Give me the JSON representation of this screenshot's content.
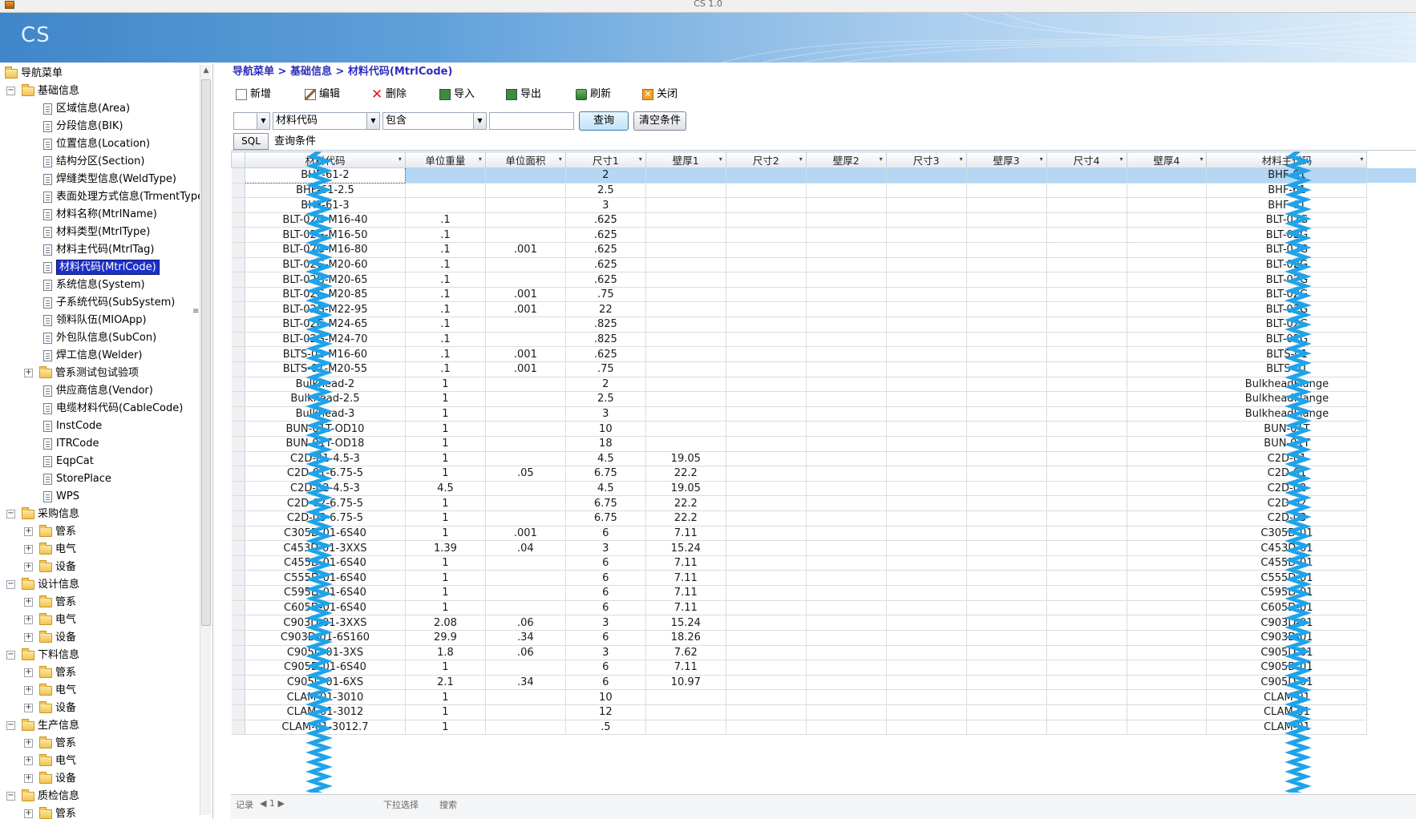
{
  "window": {
    "title": "CS 1.0"
  },
  "banner": {
    "logo": "CS"
  },
  "nav": {
    "root": "导航菜单",
    "items": [
      {
        "label": "基础信息",
        "level": 1,
        "kind": "folder",
        "expander": "−"
      },
      {
        "label": "区域信息(Area)",
        "level": 2,
        "kind": "doc"
      },
      {
        "label": "分段信息(BIK)",
        "level": 2,
        "kind": "doc"
      },
      {
        "label": "位置信息(Location)",
        "level": 2,
        "kind": "doc"
      },
      {
        "label": "结构分区(Section)",
        "level": 2,
        "kind": "doc"
      },
      {
        "label": "焊缝类型信息(WeldType)",
        "level": 2,
        "kind": "doc"
      },
      {
        "label": "表面处理方式信息(TrmentType)",
        "level": 2,
        "kind": "doc"
      },
      {
        "label": "材料名称(MtrlName)",
        "level": 2,
        "kind": "doc"
      },
      {
        "label": "材料类型(MtrlType)",
        "level": 2,
        "kind": "doc"
      },
      {
        "label": "材料主代码(MtrlTag)",
        "level": 2,
        "kind": "doc"
      },
      {
        "label": "材料代码(MtrlCode)",
        "level": 2,
        "kind": "doc",
        "selected": true
      },
      {
        "label": "系统信息(System)",
        "level": 2,
        "kind": "doc"
      },
      {
        "label": "子系统代码(SubSystem)",
        "level": 2,
        "kind": "doc"
      },
      {
        "label": "领料队伍(MIOApp)",
        "level": 2,
        "kind": "doc"
      },
      {
        "label": "外包队信息(SubCon)",
        "level": 2,
        "kind": "doc"
      },
      {
        "label": "焊工信息(Welder)",
        "level": 2,
        "kind": "doc"
      },
      {
        "label": "管系测试包试验项",
        "level": 2,
        "kind": "folder",
        "expander": "+"
      },
      {
        "label": "供应商信息(Vendor)",
        "level": 2,
        "kind": "doc"
      },
      {
        "label": "电缆材料代码(CableCode)",
        "level": 2,
        "kind": "doc"
      },
      {
        "label": "InstCode",
        "level": 2,
        "kind": "doc"
      },
      {
        "label": "ITRCode",
        "level": 2,
        "kind": "doc"
      },
      {
        "label": "EqpCat",
        "level": 2,
        "kind": "doc"
      },
      {
        "label": "StorePlace",
        "level": 2,
        "kind": "doc"
      },
      {
        "label": "WPS",
        "level": 2,
        "kind": "doc"
      },
      {
        "label": "采购信息",
        "level": 1,
        "kind": "folder",
        "expander": "−"
      },
      {
        "label": "管系",
        "level": 2,
        "kind": "folder",
        "expander": "+"
      },
      {
        "label": "电气",
        "level": 2,
        "kind": "folder",
        "expander": "+"
      },
      {
        "label": "设备",
        "level": 2,
        "kind": "folder",
        "expander": "+"
      },
      {
        "label": "设计信息",
        "level": 1,
        "kind": "folder",
        "expander": "−"
      },
      {
        "label": "管系",
        "level": 2,
        "kind": "folder",
        "expander": "+"
      },
      {
        "label": "电气",
        "level": 2,
        "kind": "folder",
        "expander": "+"
      },
      {
        "label": "设备",
        "level": 2,
        "kind": "folder",
        "expander": "+"
      },
      {
        "label": "下料信息",
        "level": 1,
        "kind": "folder",
        "expander": "−"
      },
      {
        "label": "管系",
        "level": 2,
        "kind": "folder",
        "expander": "+"
      },
      {
        "label": "电气",
        "level": 2,
        "kind": "folder",
        "expander": "+"
      },
      {
        "label": "设备",
        "level": 2,
        "kind": "folder",
        "expander": "+"
      },
      {
        "label": "生产信息",
        "level": 1,
        "kind": "folder",
        "expander": "−"
      },
      {
        "label": "管系",
        "level": 2,
        "kind": "folder",
        "expander": "+"
      },
      {
        "label": "电气",
        "level": 2,
        "kind": "folder",
        "expander": "+"
      },
      {
        "label": "设备",
        "level": 2,
        "kind": "folder",
        "expander": "+"
      },
      {
        "label": "质检信息",
        "level": 1,
        "kind": "folder",
        "expander": "−"
      },
      {
        "label": "管系",
        "level": 2,
        "kind": "folder",
        "expander": "+"
      }
    ]
  },
  "breadcrumb": "导航菜单 > 基础信息 > 材料代码(MtrlCode)",
  "toolbar": {
    "new": "新增",
    "edit": "编辑",
    "delete": "删除",
    "import": "导入",
    "export": "导出",
    "refresh": "刷新",
    "close": "关闭"
  },
  "filter": {
    "logic_value": "",
    "field_value": "材料代码",
    "operator_value": "包含",
    "keyword_value": "",
    "query": "查询",
    "clear": "清空条件"
  },
  "sqlbar": {
    "sql": "SQL",
    "label": "查询条件"
  },
  "grid": {
    "columns": [
      "材料代码",
      "单位重量",
      "单位面积",
      "尺寸1",
      "壁厚1",
      "尺寸2",
      "壁厚2",
      "尺寸3",
      "壁厚3",
      "尺寸4",
      "壁厚4",
      "材料主代码"
    ],
    "rows": [
      [
        "BHF-61-2",
        "",
        "",
        "2",
        "",
        "",
        "",
        "",
        "",
        "",
        "",
        "BHF-61"
      ],
      [
        "BHF-61-2.5",
        "",
        "",
        "2.5",
        "",
        "",
        "",
        "",
        "",
        "",
        "",
        "BHF-61"
      ],
      [
        "BHF-61-3",
        "",
        "",
        "3",
        "",
        "",
        "",
        "",
        "",
        "",
        "",
        "BHF-61"
      ],
      [
        "BLT-02G-M16-40",
        ".1",
        "",
        ".625",
        "",
        "",
        "",
        "",
        "",
        "",
        "",
        "BLT-02G"
      ],
      [
        "BLT-02G-M16-50",
        ".1",
        "",
        ".625",
        "",
        "",
        "",
        "",
        "",
        "",
        "",
        "BLT-02G"
      ],
      [
        "BLT-02G-M16-80",
        ".1",
        ".001",
        ".625",
        "",
        "",
        "",
        "",
        "",
        "",
        "",
        "BLT-02G"
      ],
      [
        "BLT-02G-M20-60",
        ".1",
        "",
        ".625",
        "",
        "",
        "",
        "",
        "",
        "",
        "",
        "BLT-02G"
      ],
      [
        "BLT-02G-M20-65",
        ".1",
        "",
        ".625",
        "",
        "",
        "",
        "",
        "",
        "",
        "",
        "BLT-02G"
      ],
      [
        "BLT-02G-M20-85",
        ".1",
        ".001",
        ".75",
        "",
        "",
        "",
        "",
        "",
        "",
        "",
        "BLT-02G"
      ],
      [
        "BLT-02G-M22-95",
        ".1",
        ".001",
        "22",
        "",
        "",
        "",
        "",
        "",
        "",
        "",
        "BLT-02G"
      ],
      [
        "BLT-02G-M24-65",
        ".1",
        "",
        ".825",
        "",
        "",
        "",
        "",
        "",
        "",
        "",
        "BLT-02G"
      ],
      [
        "BLT-02G-M24-70",
        ".1",
        "",
        ".825",
        "",
        "",
        "",
        "",
        "",
        "",
        "",
        "BLT-02G"
      ],
      [
        "BLTS-01-M16-60",
        ".1",
        ".001",
        ".625",
        "",
        "",
        "",
        "",
        "",
        "",
        "",
        "BLTS-01"
      ],
      [
        "BLTS-01-M20-55",
        ".1",
        ".001",
        ".75",
        "",
        "",
        "",
        "",
        "",
        "",
        "",
        "BLTS-01"
      ],
      [
        "Bulkhead-2",
        "1",
        "",
        "2",
        "",
        "",
        "",
        "",
        "",
        "",
        "",
        "BulkheadFlange"
      ],
      [
        "Bulkhead-2.5",
        "1",
        "",
        "2.5",
        "",
        "",
        "",
        "",
        "",
        "",
        "",
        "BulkheadFlange"
      ],
      [
        "Bulkhead-3",
        "1",
        "",
        "3",
        "",
        "",
        "",
        "",
        "",
        "",
        "",
        "BulkheadFlange"
      ],
      [
        "BUN-01T-OD10",
        "1",
        "",
        "10",
        "",
        "",
        "",
        "",
        "",
        "",
        "",
        "BUN-01T"
      ],
      [
        "BUN-01T-OD18",
        "1",
        "",
        "18",
        "",
        "",
        "",
        "",
        "",
        "",
        "",
        "BUN-01T"
      ],
      [
        "C2D-01-4.5-3",
        "1",
        "",
        "4.5",
        "19.05",
        "",
        "",
        "",
        "",
        "",
        "",
        "C2D-01"
      ],
      [
        "C2D-01-6.75-5",
        "1",
        ".05",
        "6.75",
        "22.2",
        "",
        "",
        "",
        "",
        "",
        "",
        "C2D-01"
      ],
      [
        "C2D-02-4.5-3",
        "4.5",
        "",
        "4.5",
        "19.05",
        "",
        "",
        "",
        "",
        "",
        "",
        "C2D-02"
      ],
      [
        "C2D-02-6.75-5",
        "1",
        "",
        "6.75",
        "22.2",
        "",
        "",
        "",
        "",
        "",
        "",
        "C2D-02"
      ],
      [
        "C2D-03-6.75-5",
        "1",
        "",
        "6.75",
        "22.2",
        "",
        "",
        "",
        "",
        "",
        "",
        "C2D-03"
      ],
      [
        "C305D-01-6S40",
        "1",
        ".001",
        "6",
        "7.11",
        "",
        "",
        "",
        "",
        "",
        "",
        "C305D-01"
      ],
      [
        "C453D-01-3XXS",
        "1.39",
        ".04",
        "3",
        "15.24",
        "",
        "",
        "",
        "",
        "",
        "",
        "C453D-01"
      ],
      [
        "C455D-01-6S40",
        "1",
        "",
        "6",
        "7.11",
        "",
        "",
        "",
        "",
        "",
        "",
        "C455D-01"
      ],
      [
        "C555D-01-6S40",
        "1",
        "",
        "6",
        "7.11",
        "",
        "",
        "",
        "",
        "",
        "",
        "C555D-01"
      ],
      [
        "C595D-01-6S40",
        "1",
        "",
        "6",
        "7.11",
        "",
        "",
        "",
        "",
        "",
        "",
        "C595D-01"
      ],
      [
        "C605D-01-6S40",
        "1",
        "",
        "6",
        "7.11",
        "",
        "",
        "",
        "",
        "",
        "",
        "C605D-01"
      ],
      [
        "C903D-01-3XXS",
        "2.08",
        ".06",
        "3",
        "15.24",
        "",
        "",
        "",
        "",
        "",
        "",
        "C903D-01"
      ],
      [
        "C903D-01-6S160",
        "29.9",
        ".34",
        "6",
        "18.26",
        "",
        "",
        "",
        "",
        "",
        "",
        "C903D-01"
      ],
      [
        "C905D-01-3XS",
        "1.8",
        ".06",
        "3",
        "7.62",
        "",
        "",
        "",
        "",
        "",
        "",
        "C905D-01"
      ],
      [
        "C905D-01-6S40",
        "1",
        "",
        "6",
        "7.11",
        "",
        "",
        "",
        "",
        "",
        "",
        "C905D-01"
      ],
      [
        "C905D-01-6XS",
        "2.1",
        ".34",
        "6",
        "10.97",
        "",
        "",
        "",
        "",
        "",
        "",
        "C905D-01"
      ],
      [
        "CLAM-01-3010",
        "1",
        "",
        "10",
        "",
        "",
        "",
        "",
        "",
        "",
        "",
        "CLAM-01"
      ],
      [
        "CLAM-01-3012",
        "1",
        "",
        "12",
        "",
        "",
        "",
        "",
        "",
        "",
        "",
        "CLAM-01"
      ],
      [
        "CLAM-01-3012.7",
        "1",
        "",
        ".5",
        "",
        "",
        "",
        "",
        "",
        "",
        "",
        "CLAM-01"
      ]
    ],
    "selected_row": 0
  },
  "pager": {
    "records_label": "记录",
    "nav": "◀ 1 ▶",
    "filter_label": "下拉选择",
    "search_label": "搜索"
  },
  "colors": {
    "breadcrumb": "#2d2fbb",
    "selection": "#b3d7f5",
    "nav_selected": "#1c2fc7",
    "redaction": "#1fa3e8"
  },
  "icons": {
    "new": "new-doc-icon",
    "edit": "pencil-icon",
    "delete": "x-icon",
    "import": "import-icon",
    "export": "export-icon",
    "refresh": "refresh-icon",
    "close": "close-icon",
    "folder": "folder-icon",
    "document": "document-icon"
  }
}
